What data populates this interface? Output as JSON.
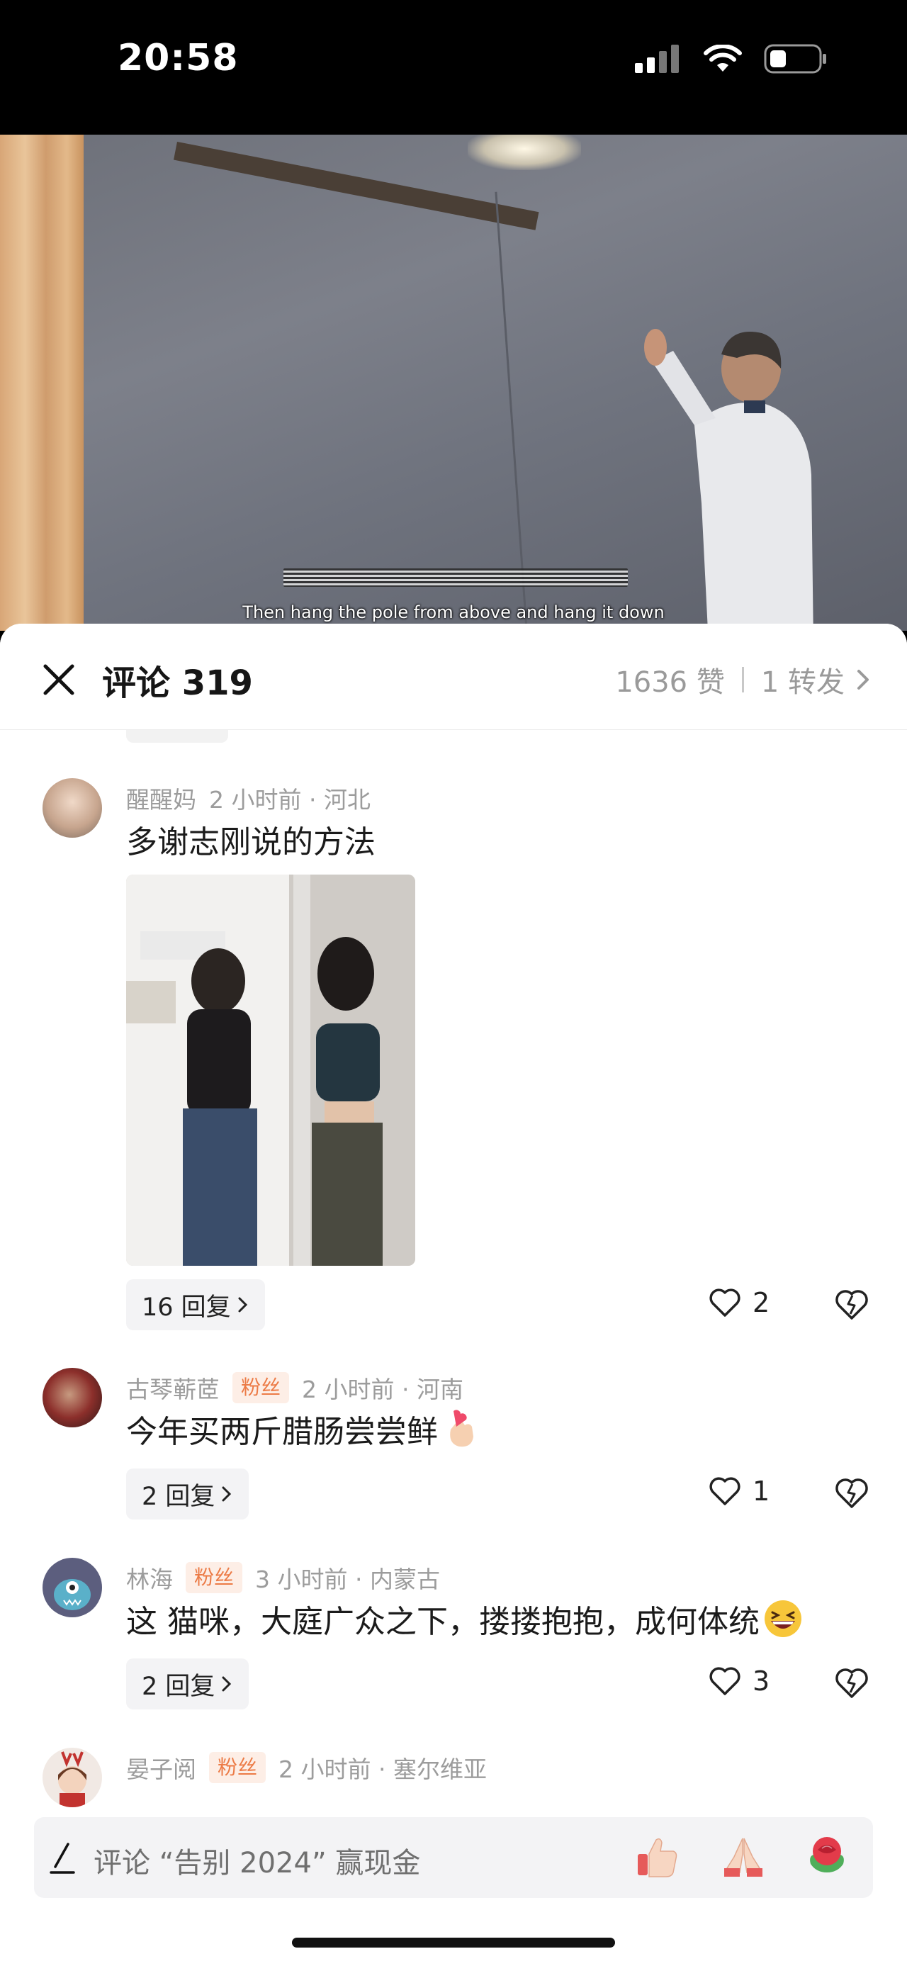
{
  "status_bar": {
    "time": "20:58"
  },
  "video": {
    "subtitle": "Then hang the pole from above and hang it down"
  },
  "header": {
    "title": "评论 319",
    "likes": "1636 赞",
    "shares": "1 转发"
  },
  "comments": [
    {
      "username": "醒醒妈",
      "time": "2 小时前 · 河北",
      "text": "多谢志刚说的方法",
      "replies": "16 回复",
      "likes": "2"
    },
    {
      "username": "古琴蕲茝",
      "fan_tag": "粉丝",
      "time": "2 小时前 · 河南",
      "text": "今年买两斤腊肠尝尝鲜",
      "replies": "2 回复",
      "likes": "1"
    },
    {
      "username": "林海",
      "fan_tag": "粉丝",
      "time": "3 小时前 · 内蒙古",
      "text": "这 猫咪，大庭广众之下，搂搂抱抱，成何体统",
      "replies": "2 回复",
      "likes": "3"
    },
    {
      "username": "晏子阅",
      "fan_tag": "粉丝",
      "time": "2 小时前 · 塞尔维亚"
    }
  ],
  "input": {
    "placeholder": "评论 “告别 2024” 赢现金"
  },
  "icons": [
    "close-icon",
    "chevron-right-icon",
    "heart-icon",
    "broken-heart-icon",
    "pen-icon",
    "thumbs-up-emoji",
    "pray-emoji",
    "rose-emoji"
  ],
  "colors": {
    "fan_tag_text": "#ec7b46",
    "fan_tag_bg": "#fdeee6",
    "meta_text": "#9c9c9c"
  }
}
